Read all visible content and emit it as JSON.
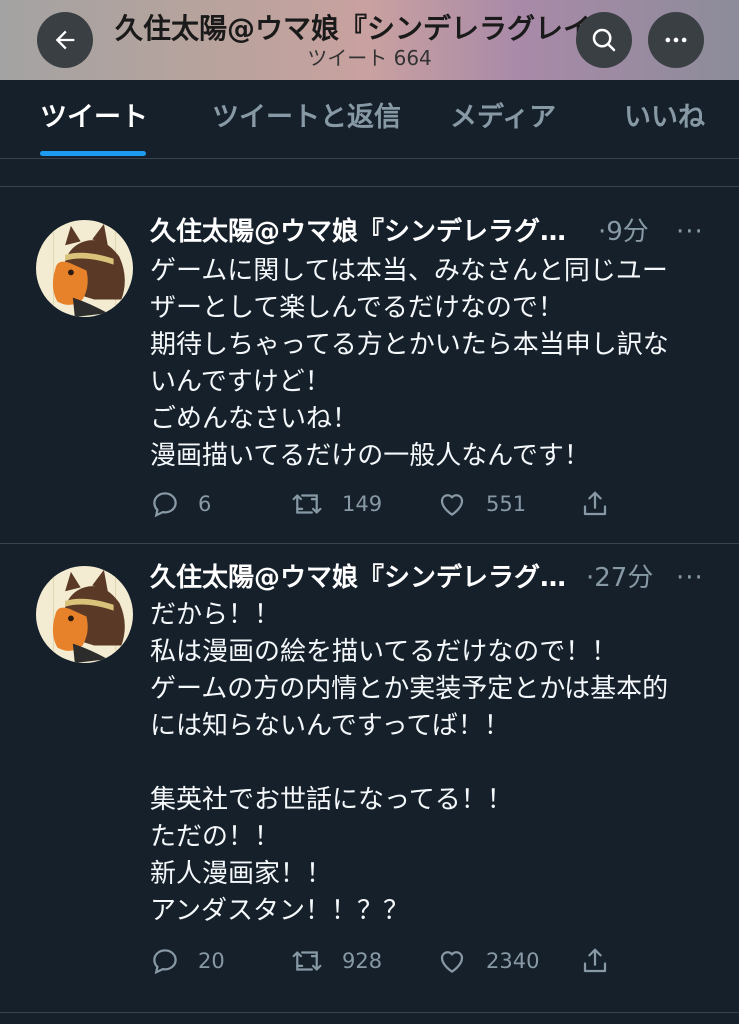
{
  "header": {
    "title": "久住太陽@ウマ娘『シンデレラグレイ",
    "subtitle": "ツイート 664",
    "back_icon": "arrow-left-icon",
    "search_icon": "search-icon",
    "more_icon": "more-horizontal-icon"
  },
  "tabs": [
    {
      "label": "ツイート",
      "active": true
    },
    {
      "label": "ツイートと返信",
      "active": false
    },
    {
      "label": "メディア",
      "active": false
    },
    {
      "label": "いいね",
      "active": false
    }
  ],
  "tweets": [
    {
      "name": "久住太陽@ウマ娘『シンデレラグ…",
      "time": "·9分",
      "more": "···",
      "lines": [
        "ゲームに関しては本当、みなさんと同じユー",
        "ザーとして楽しんでるだけなので！",
        "期待しちゃってる方とかいたら本当申し訳な",
        "いんですけど！",
        "ごめんなさいね！",
        "漫画描いてるだけの一般人なんです！"
      ],
      "replies": "6",
      "retweets": "149",
      "likes": "551"
    },
    {
      "name": "久住太陽@ウマ娘『シンデレラグ…",
      "time": "·27分",
      "more": "···",
      "lines": [
        "だから！！",
        "私は漫画の絵を描いてるだけなので！！",
        "ゲームの方の内情とか実装予定とかは基本的",
        "には知らないんですってば！！",
        "",
        "集英社でお世話になってる！！",
        "ただの！！",
        "新人漫画家！！",
        "アンダスタン！！？？"
      ],
      "replies": "20",
      "retweets": "928",
      "likes": "2340"
    }
  ],
  "colors": {
    "background": "#15202b",
    "accent": "#1d9bf0",
    "muted": "#8899a6",
    "divider": "#38444d"
  }
}
